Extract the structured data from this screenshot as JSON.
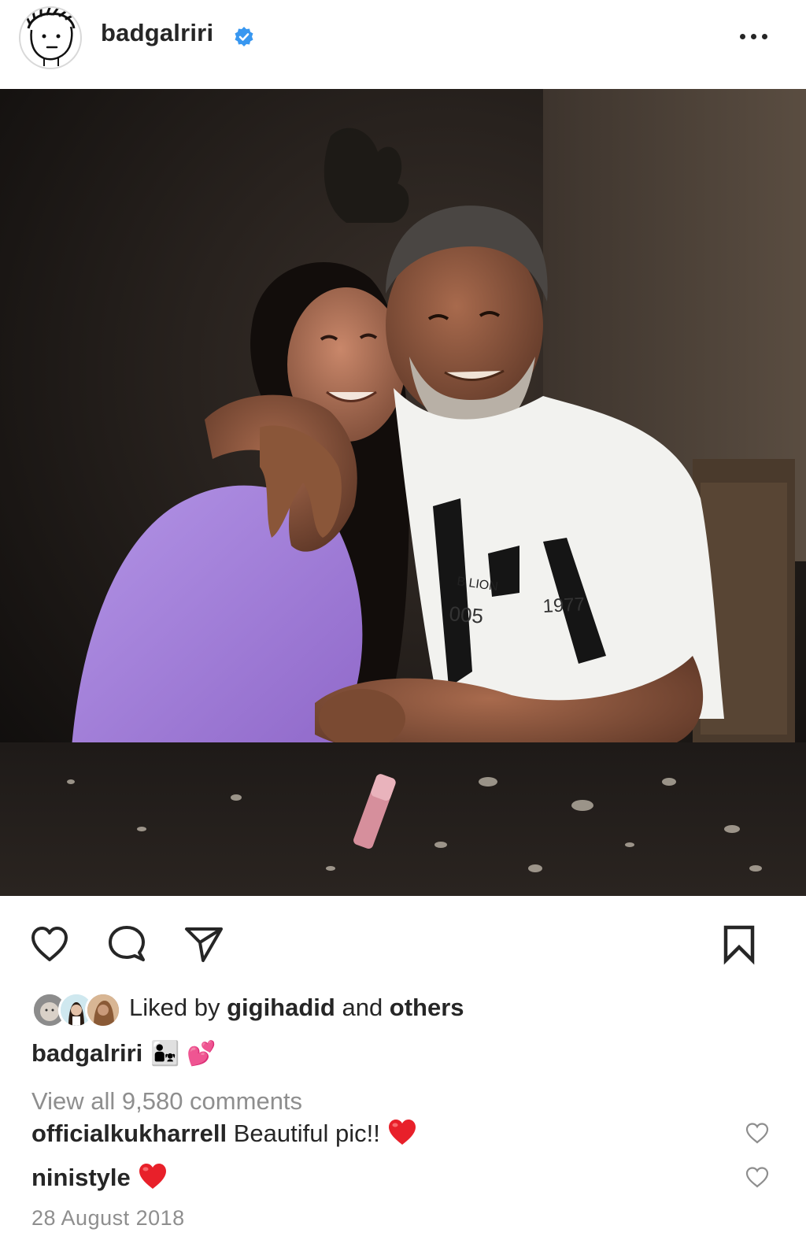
{
  "post": {
    "username": "badgalriri",
    "verified_icon": "verified-badge-icon",
    "more_icon": "more-options-icon",
    "photo_description_icon": "post-photo",
    "actions": {
      "like_icon": "heart-outline-icon",
      "comment_icon": "comment-bubble-icon",
      "share_icon": "paper-plane-icon",
      "save_icon": "bookmark-icon"
    },
    "likes": {
      "prefix": "Liked by ",
      "user": "gigihadid",
      "middle": " and ",
      "others": "others"
    },
    "caption": {
      "user": "badgalriri",
      "text": "👨‍👧 💕"
    },
    "view_comments": "View all 9,580 comments",
    "comments": [
      {
        "user": "officialkukharrell",
        "text": " Beautiful pic!!"
      },
      {
        "user": "ninistyle",
        "text": ""
      }
    ],
    "date": "28 August 2018",
    "colors": {
      "verified": "#3897f0",
      "text_primary": "#262626",
      "text_secondary": "#8e8e8e",
      "heart_red": "#e8202a"
    }
  }
}
